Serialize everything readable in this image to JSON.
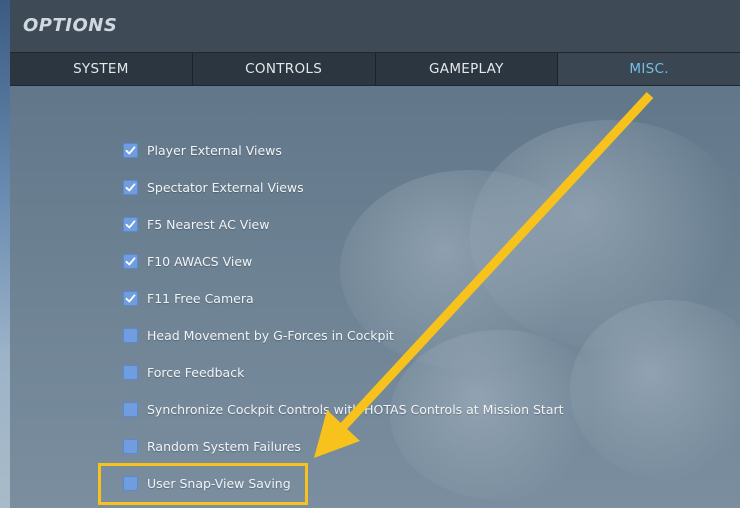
{
  "window": {
    "title": "OPTIONS"
  },
  "tabs": [
    {
      "label": "SYSTEM",
      "active": false
    },
    {
      "label": "CONTROLS",
      "active": false
    },
    {
      "label": "GAMEPLAY",
      "active": false
    },
    {
      "label": "MISC.",
      "active": true
    }
  ],
  "options": [
    {
      "label": "Player External Views",
      "checked": true
    },
    {
      "label": "Spectator External Views",
      "checked": true
    },
    {
      "label": "F5 Nearest AC View",
      "checked": true
    },
    {
      "label": "F10 AWACS View",
      "checked": true
    },
    {
      "label": "F11 Free Camera",
      "checked": true
    },
    {
      "label": "Head Movement by G-Forces in Cockpit",
      "checked": false
    },
    {
      "label": "Force Feedback",
      "checked": false
    },
    {
      "label": "Synchronize Cockpit Controls with HOTAS Controls at Mission Start",
      "checked": false
    },
    {
      "label": "Random System Failures",
      "checked": false
    },
    {
      "label": "User Snap-View Saving",
      "checked": false
    }
  ],
  "annotation": {
    "color": "#f6c21b",
    "checkbox_color": "#6f9de0",
    "active_tab_color": "#74c0e4"
  }
}
